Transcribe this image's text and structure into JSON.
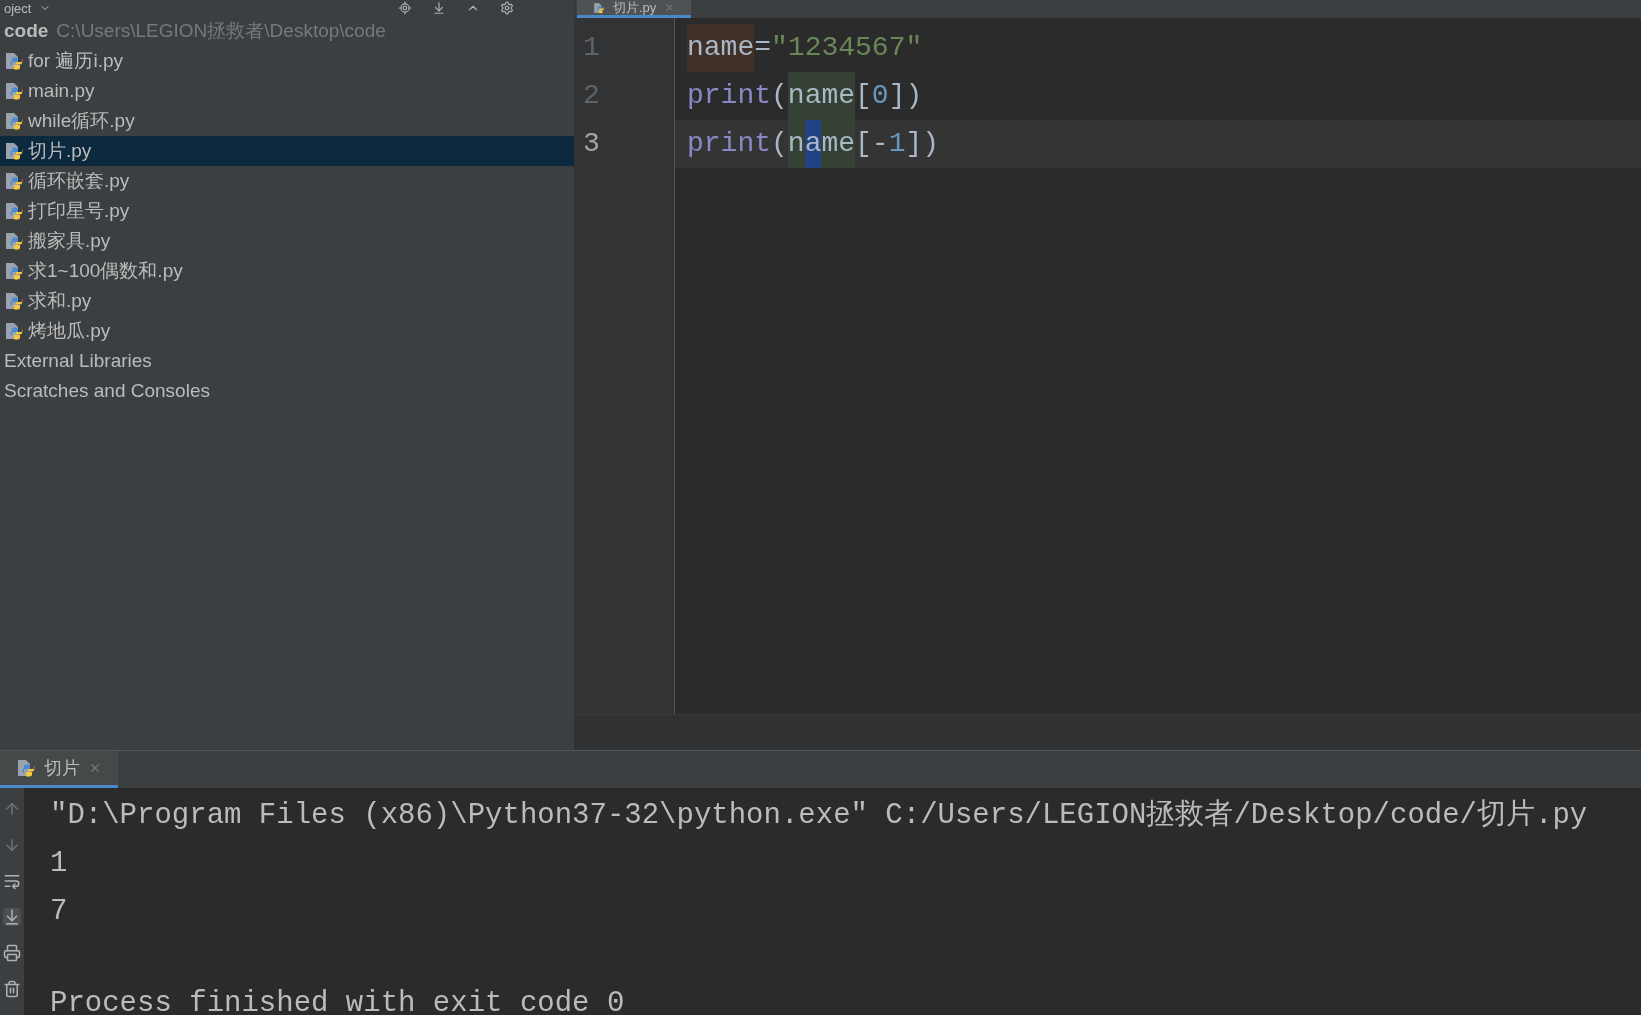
{
  "project_panel": {
    "title": "oject",
    "root": {
      "name": "code",
      "path": "C:\\Users\\LEGION拯救者\\Desktop\\code"
    },
    "items": [
      {
        "kind": "python",
        "label": "for 遍历i.py",
        "selected": false
      },
      {
        "kind": "python",
        "label": "main.py",
        "selected": false
      },
      {
        "kind": "python",
        "label": "while循环.py",
        "selected": false
      },
      {
        "kind": "python",
        "label": "切片.py",
        "selected": true
      },
      {
        "kind": "python",
        "label": "循环嵌套.py",
        "selected": false
      },
      {
        "kind": "python",
        "label": "打印星号.py",
        "selected": false
      },
      {
        "kind": "python",
        "label": "搬家具.py",
        "selected": false
      },
      {
        "kind": "python",
        "label": "求1~100偶数和.py",
        "selected": false
      },
      {
        "kind": "python",
        "label": "求和.py",
        "selected": false
      },
      {
        "kind": "python",
        "label": "烤地瓜.py",
        "selected": false
      },
      {
        "kind": "plain",
        "label": "External Libraries",
        "selected": false
      },
      {
        "kind": "plain",
        "label": "Scratches and Consoles",
        "selected": false
      }
    ]
  },
  "editor": {
    "tabs": [
      {
        "label": "切片.py",
        "selected": true
      }
    ],
    "lines": [
      {
        "number": "1",
        "current": false,
        "tokens": [
          {
            "kind": "var-def",
            "text": "name"
          },
          {
            "kind": "op",
            "text": "="
          },
          {
            "kind": "string",
            "text": "\"1234567\""
          }
        ]
      },
      {
        "number": "2",
        "current": false,
        "tokens": [
          {
            "kind": "builtin",
            "text": "print"
          },
          {
            "kind": "op",
            "text": "("
          },
          {
            "kind": "var-use",
            "text": "name"
          },
          {
            "kind": "op",
            "text": "["
          },
          {
            "kind": "number",
            "text": "0"
          },
          {
            "kind": "op",
            "text": "])"
          }
        ]
      },
      {
        "number": "3",
        "current": true,
        "tokens": [
          {
            "kind": "builtin",
            "text": "print"
          },
          {
            "kind": "op",
            "text": "("
          },
          {
            "kind": "var-use",
            "text": "n"
          },
          {
            "kind": "var-caret",
            "text": "a"
          },
          {
            "kind": "var-use",
            "text": "me"
          },
          {
            "kind": "op",
            "text": "[-"
          },
          {
            "kind": "number",
            "text": "1"
          },
          {
            "kind": "op",
            "text": "])"
          }
        ]
      }
    ]
  },
  "run_panel": {
    "tabs": [
      {
        "label": "切片",
        "selected": true
      }
    ],
    "output": [
      "\"D:\\Program Files (x86)\\Python37-32\\python.exe\" C:/Users/LEGION拯救者/Desktop/code/切片.py",
      "1",
      "7"
    ],
    "exit_message": "Process finished with exit code 0"
  }
}
